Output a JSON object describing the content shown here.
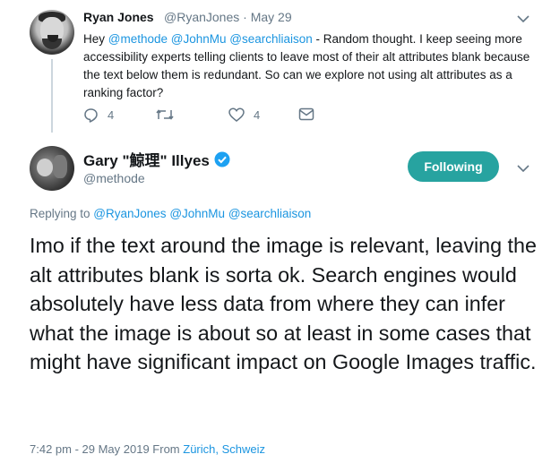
{
  "reply_tweet": {
    "author_name": "Ryan Jones",
    "author_handle": "@RyanJones",
    "separator": "·",
    "date": "May 29",
    "text_prefix": "Hey ",
    "mentions": [
      "@methode",
      "@JohnMu",
      "@searchliaison"
    ],
    "text_body": " - Random thought. I keep seeing more accessibility experts telling clients to leave most of their alt attributes blank because the text below them is redundant. So can we explore not using alt attributes as a ranking factor?",
    "reply_count": "4",
    "retweet_count": "",
    "like_count": "4"
  },
  "main_tweet": {
    "author_name": "Gary \"鯨理\" Illyes",
    "author_handle": "@methode",
    "verified": true,
    "follow_button_label": "Following",
    "replying_prefix": "Replying to ",
    "replying_mentions": [
      "@RyanJones",
      "@JohnMu",
      "@searchliaison"
    ],
    "text": "Imo if the text around the image is relevant, leaving the alt attributes blank is sorta ok. Search engines would absolutely have less data from where they can infer what the image is about so at least in some cases that might have significant impact on Google Images traffic.",
    "timestamp": "7:42 pm - 29 May 2019 From ",
    "location": "Zürich, Schweiz"
  },
  "colors": {
    "link": "#1b95e0",
    "muted": "#657786",
    "text": "#14171a",
    "follow_button": "#27a3a0",
    "verified_badge": "#1da1f2"
  },
  "icons": [
    "reply-icon",
    "retweet-icon",
    "like-icon",
    "dm-icon",
    "chevron-down-icon",
    "verified-badge-icon"
  ]
}
